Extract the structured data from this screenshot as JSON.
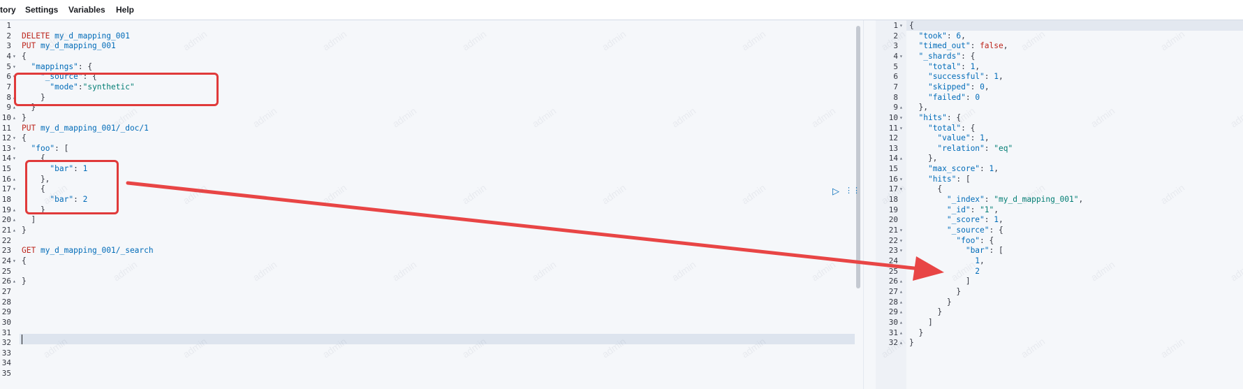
{
  "menu": {
    "items": [
      "tory",
      "Settings",
      "Variables",
      "Help"
    ]
  },
  "editor": {
    "lines": [
      {
        "n": "1",
        "fold": "",
        "tokens": []
      },
      {
        "n": "2",
        "fold": "",
        "tokens": [
          [
            "m",
            "DELETE"
          ],
          [
            "pun",
            " "
          ],
          [
            "p",
            "my_d_mapping_001"
          ]
        ]
      },
      {
        "n": "3",
        "fold": "",
        "tokens": [
          [
            "m",
            "PUT"
          ],
          [
            "pun",
            " "
          ],
          [
            "p",
            "my_d_mapping_001"
          ]
        ]
      },
      {
        "n": "4",
        "fold": "▾",
        "tokens": [
          [
            "pun",
            "{"
          ]
        ]
      },
      {
        "n": "5",
        "fold": "▾",
        "tokens": [
          [
            "pun",
            "  "
          ],
          [
            "k",
            "\"mappings\""
          ],
          [
            "pun",
            ": {"
          ]
        ]
      },
      {
        "n": "6",
        "fold": "▾",
        "tokens": [
          [
            "pun",
            "    "
          ],
          [
            "k",
            "\"_source\""
          ],
          [
            "pun",
            ": {"
          ]
        ]
      },
      {
        "n": "7",
        "fold": "",
        "tokens": [
          [
            "pun",
            "      "
          ],
          [
            "k",
            "\"mode\""
          ],
          [
            "pun",
            ":"
          ],
          [
            "s",
            "\"synthetic\""
          ]
        ]
      },
      {
        "n": "8",
        "fold": "▴",
        "tokens": [
          [
            "pun",
            "    }"
          ]
        ]
      },
      {
        "n": "9",
        "fold": "▴",
        "tokens": [
          [
            "pun",
            "  }"
          ]
        ]
      },
      {
        "n": "10",
        "fold": "▴",
        "tokens": [
          [
            "pun",
            "}"
          ]
        ]
      },
      {
        "n": "11",
        "fold": "",
        "tokens": [
          [
            "m",
            "PUT"
          ],
          [
            "pun",
            " "
          ],
          [
            "p",
            "my_d_mapping_001/_doc/1"
          ]
        ]
      },
      {
        "n": "12",
        "fold": "▾",
        "tokens": [
          [
            "pun",
            "{"
          ]
        ]
      },
      {
        "n": "13",
        "fold": "▾",
        "tokens": [
          [
            "pun",
            "  "
          ],
          [
            "k",
            "\"foo\""
          ],
          [
            "pun",
            ": ["
          ]
        ]
      },
      {
        "n": "14",
        "fold": "▾",
        "tokens": [
          [
            "pun",
            "    {"
          ]
        ]
      },
      {
        "n": "15",
        "fold": "",
        "tokens": [
          [
            "pun",
            "      "
          ],
          [
            "k",
            "\"bar\""
          ],
          [
            "pun",
            ": "
          ],
          [
            "n",
            "1"
          ]
        ]
      },
      {
        "n": "16",
        "fold": "▴",
        "tokens": [
          [
            "pun",
            "    },"
          ]
        ]
      },
      {
        "n": "17",
        "fold": "▾",
        "tokens": [
          [
            "pun",
            "    {"
          ]
        ]
      },
      {
        "n": "18",
        "fold": "",
        "tokens": [
          [
            "pun",
            "      "
          ],
          [
            "k",
            "\"bar\""
          ],
          [
            "pun",
            ": "
          ],
          [
            "n",
            "2"
          ]
        ]
      },
      {
        "n": "19",
        "fold": "▴",
        "tokens": [
          [
            "pun",
            "    }"
          ]
        ]
      },
      {
        "n": "20",
        "fold": "▴",
        "tokens": [
          [
            "pun",
            "  ]"
          ]
        ]
      },
      {
        "n": "21",
        "fold": "▴",
        "tokens": [
          [
            "pun",
            "}"
          ]
        ]
      },
      {
        "n": "22",
        "fold": "",
        "tokens": []
      },
      {
        "n": "23",
        "fold": "",
        "tokens": [
          [
            "m",
            "GET"
          ],
          [
            "pun",
            " "
          ],
          [
            "p",
            "my_d_mapping_001/_search"
          ]
        ]
      },
      {
        "n": "24",
        "fold": "▾",
        "tokens": [
          [
            "pun",
            "{"
          ]
        ]
      },
      {
        "n": "25",
        "fold": "",
        "tokens": []
      },
      {
        "n": "26",
        "fold": "▴",
        "tokens": [
          [
            "pun",
            "}"
          ]
        ]
      },
      {
        "n": "27",
        "fold": "",
        "tokens": []
      },
      {
        "n": "28",
        "fold": "",
        "tokens": []
      },
      {
        "n": "29",
        "fold": "",
        "tokens": []
      },
      {
        "n": "30",
        "fold": "",
        "tokens": []
      },
      {
        "n": "31",
        "fold": "",
        "tokens": []
      },
      {
        "n": "32",
        "fold": "",
        "tokens": []
      },
      {
        "n": "33",
        "fold": "",
        "tokens": []
      },
      {
        "n": "34",
        "fold": "",
        "tokens": []
      },
      {
        "n": "35",
        "fold": "",
        "tokens": []
      }
    ]
  },
  "response": {
    "lines": [
      {
        "n": "1",
        "fold": "▾",
        "tokens": [
          [
            "pun",
            "{"
          ]
        ]
      },
      {
        "n": "2",
        "fold": "",
        "tokens": [
          [
            "pun",
            "  "
          ],
          [
            "k",
            "\"took\""
          ],
          [
            "pun",
            ": "
          ],
          [
            "n",
            "6"
          ],
          [
            "pun",
            ","
          ]
        ]
      },
      {
        "n": "3",
        "fold": "",
        "tokens": [
          [
            "pun",
            "  "
          ],
          [
            "k",
            "\"timed_out\""
          ],
          [
            "pun",
            ": "
          ],
          [
            "kw",
            "false"
          ],
          [
            "pun",
            ","
          ]
        ]
      },
      {
        "n": "4",
        "fold": "▾",
        "tokens": [
          [
            "pun",
            "  "
          ],
          [
            "k",
            "\"_shards\""
          ],
          [
            "pun",
            ": {"
          ]
        ]
      },
      {
        "n": "5",
        "fold": "",
        "tokens": [
          [
            "pun",
            "    "
          ],
          [
            "k",
            "\"total\""
          ],
          [
            "pun",
            ": "
          ],
          [
            "n",
            "1"
          ],
          [
            "pun",
            ","
          ]
        ]
      },
      {
        "n": "6",
        "fold": "",
        "tokens": [
          [
            "pun",
            "    "
          ],
          [
            "k",
            "\"successful\""
          ],
          [
            "pun",
            ": "
          ],
          [
            "n",
            "1"
          ],
          [
            "pun",
            ","
          ]
        ]
      },
      {
        "n": "7",
        "fold": "",
        "tokens": [
          [
            "pun",
            "    "
          ],
          [
            "k",
            "\"skipped\""
          ],
          [
            "pun",
            ": "
          ],
          [
            "n",
            "0"
          ],
          [
            "pun",
            ","
          ]
        ]
      },
      {
        "n": "8",
        "fold": "",
        "tokens": [
          [
            "pun",
            "    "
          ],
          [
            "k",
            "\"failed\""
          ],
          [
            "pun",
            ": "
          ],
          [
            "n",
            "0"
          ]
        ]
      },
      {
        "n": "9",
        "fold": "▴",
        "tokens": [
          [
            "pun",
            "  },"
          ]
        ]
      },
      {
        "n": "10",
        "fold": "▾",
        "tokens": [
          [
            "pun",
            "  "
          ],
          [
            "k",
            "\"hits\""
          ],
          [
            "pun",
            ": {"
          ]
        ]
      },
      {
        "n": "11",
        "fold": "▾",
        "tokens": [
          [
            "pun",
            "    "
          ],
          [
            "k",
            "\"total\""
          ],
          [
            "pun",
            ": {"
          ]
        ]
      },
      {
        "n": "12",
        "fold": "",
        "tokens": [
          [
            "pun",
            "      "
          ],
          [
            "k",
            "\"value\""
          ],
          [
            "pun",
            ": "
          ],
          [
            "n",
            "1"
          ],
          [
            "pun",
            ","
          ]
        ]
      },
      {
        "n": "13",
        "fold": "",
        "tokens": [
          [
            "pun",
            "      "
          ],
          [
            "k",
            "\"relation\""
          ],
          [
            "pun",
            ": "
          ],
          [
            "s",
            "\"eq\""
          ]
        ]
      },
      {
        "n": "14",
        "fold": "▴",
        "tokens": [
          [
            "pun",
            "    },"
          ]
        ]
      },
      {
        "n": "15",
        "fold": "",
        "tokens": [
          [
            "pun",
            "    "
          ],
          [
            "k",
            "\"max_score\""
          ],
          [
            "pun",
            ": "
          ],
          [
            "n",
            "1"
          ],
          [
            "pun",
            ","
          ]
        ]
      },
      {
        "n": "16",
        "fold": "▾",
        "tokens": [
          [
            "pun",
            "    "
          ],
          [
            "k",
            "\"hits\""
          ],
          [
            "pun",
            ": ["
          ]
        ]
      },
      {
        "n": "17",
        "fold": "▾",
        "tokens": [
          [
            "pun",
            "      {"
          ]
        ]
      },
      {
        "n": "18",
        "fold": "",
        "tokens": [
          [
            "pun",
            "        "
          ],
          [
            "k",
            "\"_index\""
          ],
          [
            "pun",
            ": "
          ],
          [
            "s",
            "\"my_d_mapping_001\""
          ],
          [
            "pun",
            ","
          ]
        ]
      },
      {
        "n": "19",
        "fold": "",
        "tokens": [
          [
            "pun",
            "        "
          ],
          [
            "k",
            "\"_id\""
          ],
          [
            "pun",
            ": "
          ],
          [
            "s",
            "\"1\""
          ],
          [
            "pun",
            ","
          ]
        ]
      },
      {
        "n": "20",
        "fold": "",
        "tokens": [
          [
            "pun",
            "        "
          ],
          [
            "k",
            "\"_score\""
          ],
          [
            "pun",
            ": "
          ],
          [
            "n",
            "1"
          ],
          [
            "pun",
            ","
          ]
        ]
      },
      {
        "n": "21",
        "fold": "▾",
        "tokens": [
          [
            "pun",
            "        "
          ],
          [
            "k",
            "\"_source\""
          ],
          [
            "pun",
            ": {"
          ]
        ]
      },
      {
        "n": "22",
        "fold": "▾",
        "tokens": [
          [
            "pun",
            "          "
          ],
          [
            "k",
            "\"foo\""
          ],
          [
            "pun",
            ": {"
          ]
        ]
      },
      {
        "n": "23",
        "fold": "▾",
        "tokens": [
          [
            "pun",
            "            "
          ],
          [
            "k",
            "\"bar\""
          ],
          [
            "pun",
            ": ["
          ]
        ]
      },
      {
        "n": "24",
        "fold": "",
        "tokens": [
          [
            "pun",
            "              "
          ],
          [
            "n",
            "1"
          ],
          [
            "pun",
            ","
          ]
        ]
      },
      {
        "n": "25",
        "fold": "",
        "tokens": [
          [
            "pun",
            "              "
          ],
          [
            "n",
            "2"
          ]
        ]
      },
      {
        "n": "26",
        "fold": "▴",
        "tokens": [
          [
            "pun",
            "            ]"
          ]
        ]
      },
      {
        "n": "27",
        "fold": "▴",
        "tokens": [
          [
            "pun",
            "          }"
          ]
        ]
      },
      {
        "n": "28",
        "fold": "▴",
        "tokens": [
          [
            "pun",
            "        }"
          ]
        ]
      },
      {
        "n": "29",
        "fold": "▴",
        "tokens": [
          [
            "pun",
            "      }"
          ]
        ]
      },
      {
        "n": "30",
        "fold": "▴",
        "tokens": [
          [
            "pun",
            "    ]"
          ]
        ]
      },
      {
        "n": "31",
        "fold": "▴",
        "tokens": [
          [
            "pun",
            "  }"
          ]
        ]
      },
      {
        "n": "32",
        "fold": "▴",
        "tokens": [
          [
            "pun",
            "}"
          ]
        ]
      }
    ]
  },
  "watermark": "admin",
  "colors": {
    "method": "#bd271e",
    "key": "#006bb8",
    "string": "#017d73",
    "annotation": "#e03a3a"
  },
  "icons": {
    "play": "play-icon",
    "wrench": "settings-wrench-icon"
  }
}
